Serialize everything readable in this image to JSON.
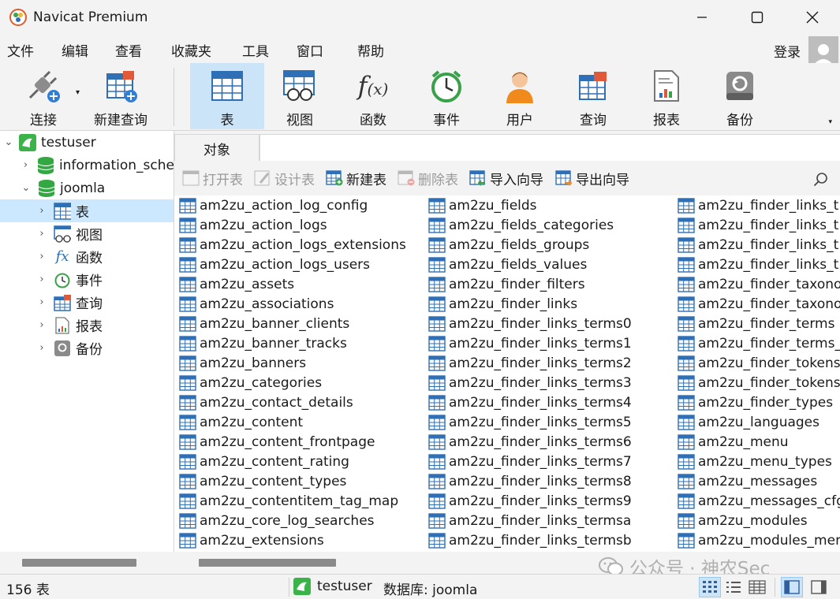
{
  "window": {
    "title": "Navicat Premium"
  },
  "menu": [
    "文件",
    "编辑",
    "查看",
    "收藏夹",
    "工具",
    "窗口",
    "帮助"
  ],
  "account": {
    "login_label": "登录"
  },
  "ribbon": {
    "connect": "连接",
    "new_query": "新建查询",
    "buttons": [
      "表",
      "视图",
      "函数",
      "事件",
      "用户",
      "查询",
      "报表",
      "备份"
    ]
  },
  "tree": {
    "connection": "testuser",
    "databases": [
      "information_sche",
      "joomla"
    ],
    "items": [
      "表",
      "视图",
      "函数",
      "事件",
      "查询",
      "报表",
      "备份"
    ]
  },
  "tabs": {
    "objects": "对象"
  },
  "object_toolbar": {
    "open": "打开表",
    "design": "设计表",
    "new": "新建表",
    "delete": "删除表",
    "import": "导入向导",
    "export": "导出向导"
  },
  "tables": {
    "col1": [
      "am2zu_action_log_config",
      "am2zu_action_logs",
      "am2zu_action_logs_extensions",
      "am2zu_action_logs_users",
      "am2zu_assets",
      "am2zu_associations",
      "am2zu_banner_clients",
      "am2zu_banner_tracks",
      "am2zu_banners",
      "am2zu_categories",
      "am2zu_contact_details",
      "am2zu_content",
      "am2zu_content_frontpage",
      "am2zu_content_rating",
      "am2zu_content_types",
      "am2zu_contentitem_tag_map",
      "am2zu_core_log_searches",
      "am2zu_extensions"
    ],
    "col2": [
      "am2zu_fields",
      "am2zu_fields_categories",
      "am2zu_fields_groups",
      "am2zu_fields_values",
      "am2zu_finder_filters",
      "am2zu_finder_links",
      "am2zu_finder_links_terms0",
      "am2zu_finder_links_terms1",
      "am2zu_finder_links_terms2",
      "am2zu_finder_links_terms3",
      "am2zu_finder_links_terms4",
      "am2zu_finder_links_terms5",
      "am2zu_finder_links_terms6",
      "am2zu_finder_links_terms7",
      "am2zu_finder_links_terms8",
      "am2zu_finder_links_terms9",
      "am2zu_finder_links_termsa",
      "am2zu_finder_links_termsb"
    ],
    "col3": [
      "am2zu_finder_links_t",
      "am2zu_finder_links_t",
      "am2zu_finder_links_t",
      "am2zu_finder_links_t",
      "am2zu_finder_taxono",
      "am2zu_finder_taxono",
      "am2zu_finder_terms",
      "am2zu_finder_terms_",
      "am2zu_finder_tokens",
      "am2zu_finder_tokens",
      "am2zu_finder_types",
      "am2zu_languages",
      "am2zu_menu",
      "am2zu_menu_types",
      "am2zu_messages",
      "am2zu_messages_cfg",
      "am2zu_modules",
      "am2zu_modules_men"
    ]
  },
  "watermark": "公众号 · 神农Sec",
  "status": {
    "count": "156 表",
    "connection": "testuser",
    "database": "数据库: joomla"
  },
  "colors": {
    "accent": "#cce4f7",
    "table_icon_blue": "#2f6fb5",
    "chrome": "#f3f3f3"
  }
}
